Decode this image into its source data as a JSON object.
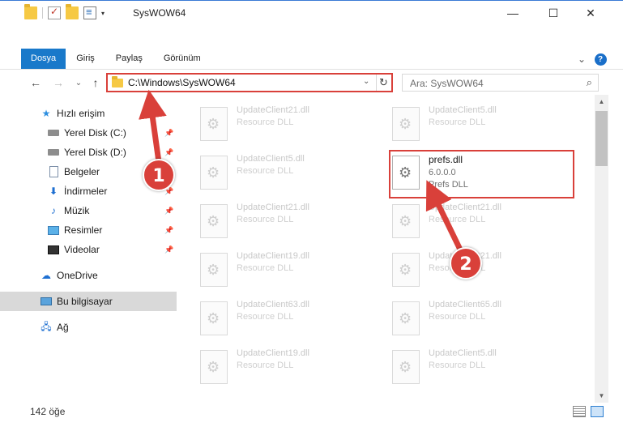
{
  "window": {
    "title": "SysWOW64",
    "minimize": "—",
    "maximize": "☐",
    "close": "✕"
  },
  "ribbon": {
    "tabs": [
      {
        "label": "Dosya"
      },
      {
        "label": "Giriş"
      },
      {
        "label": "Paylaş"
      },
      {
        "label": "Görünüm"
      }
    ],
    "collapse": "⌄",
    "help": "?"
  },
  "navigation": {
    "back": "←",
    "forward": "→",
    "recent": "⌄",
    "up": "↑"
  },
  "address": {
    "path": "C:\\Windows\\SysWOW64",
    "dropdown": "⌄",
    "refresh": "↻"
  },
  "search": {
    "placeholder": "Ara: SysWOW64",
    "icon": "⌕"
  },
  "sidebar": {
    "items": [
      {
        "label": "Hızlı erişim",
        "icon": "star-icon",
        "pinned": false
      },
      {
        "label": "Yerel Disk (C:)",
        "icon": "drive-icon",
        "pinned": true
      },
      {
        "label": "Yerel Disk (D:)",
        "icon": "drive-icon",
        "pinned": true
      },
      {
        "label": "Belgeler",
        "icon": "documents-icon",
        "pinned": true
      },
      {
        "label": "İndirmeler",
        "icon": "downloads-icon",
        "pinned": true
      },
      {
        "label": "Müzik",
        "icon": "music-icon",
        "pinned": true
      },
      {
        "label": "Resimler",
        "icon": "pictures-icon",
        "pinned": true
      },
      {
        "label": "Videolar",
        "icon": "videos-icon",
        "pinned": true
      },
      {
        "label": "OneDrive",
        "icon": "cloud-icon",
        "pinned": false
      },
      {
        "label": "Bu bilgisayar",
        "icon": "computer-icon",
        "pinned": false,
        "selected": true
      },
      {
        "label": "Ağ",
        "icon": "network-icon",
        "pinned": false
      }
    ]
  },
  "files": [
    {
      "name": "UpdateClient21.dll",
      "desc": "Resource DLL"
    },
    {
      "name": "UpdateClient5.dll",
      "desc": "Resource DLL"
    },
    {
      "name": "UpdateClient5.dll",
      "desc": "Resource DLL"
    },
    {
      "name": "prefs.dll",
      "version": "6.0.0.0",
      "desc": "Prefs DLL",
      "highlighted": true
    },
    {
      "name": "UpdateClient21.dll",
      "desc": "Resource DLL"
    },
    {
      "name": "UpdateClient21.dll",
      "desc": "Resource DLL"
    },
    {
      "name": "UpdateClient19.dll",
      "desc": "Resource DLL"
    },
    {
      "name": "UpdateClient21.dll",
      "desc": "Resource DLL"
    },
    {
      "name": "UpdateClient63.dll",
      "desc": "Resource DLL"
    },
    {
      "name": "UpdateClient65.dll",
      "desc": "Resource DLL"
    },
    {
      "name": "UpdateClient19.dll",
      "desc": "Resource DLL"
    },
    {
      "name": "UpdateClient5.dll",
      "desc": "Resource DLL"
    }
  ],
  "status": {
    "item_count": "142 öğe"
  },
  "callouts": {
    "one": "1",
    "two": "2"
  },
  "colors": {
    "accent": "#1979ca",
    "highlight": "#d9403a",
    "selected_bg": "#d9d9d9"
  }
}
